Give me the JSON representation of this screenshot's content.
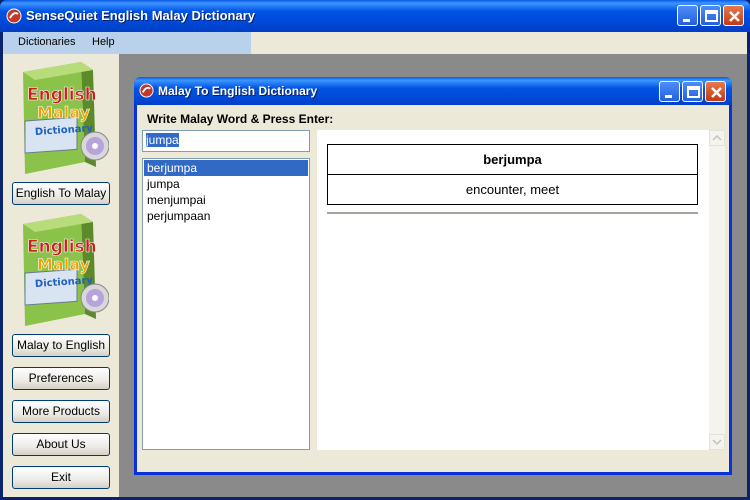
{
  "app": {
    "title": "SenseQuiet English Malay Dictionary"
  },
  "menu": {
    "items": [
      "Dictionaries",
      "Help"
    ]
  },
  "sidebar": {
    "box_text": [
      "English",
      "Malay",
      "Dictionary"
    ],
    "buttons": {
      "english_to_malay": "English To Malay",
      "malay_to_english": "Malay to English",
      "preferences": "Preferences",
      "more_products": "More Products",
      "about_us": "About Us",
      "exit": "Exit"
    }
  },
  "child_window": {
    "title": "Malay To English Dictionary",
    "prompt": "Write Malay Word & Press Enter:",
    "search_value": "jumpa",
    "words": [
      "berjumpa",
      "jumpa",
      "menjumpai",
      "perjumpaan"
    ],
    "selected_word_index": 0,
    "result": {
      "headword": "berjumpa",
      "translation": "encounter, meet"
    }
  },
  "colors": {
    "titlebar_blue": "#0054e3",
    "selection": "#316ac5",
    "close_red": "#c23a13",
    "face": "#ece9d8"
  }
}
